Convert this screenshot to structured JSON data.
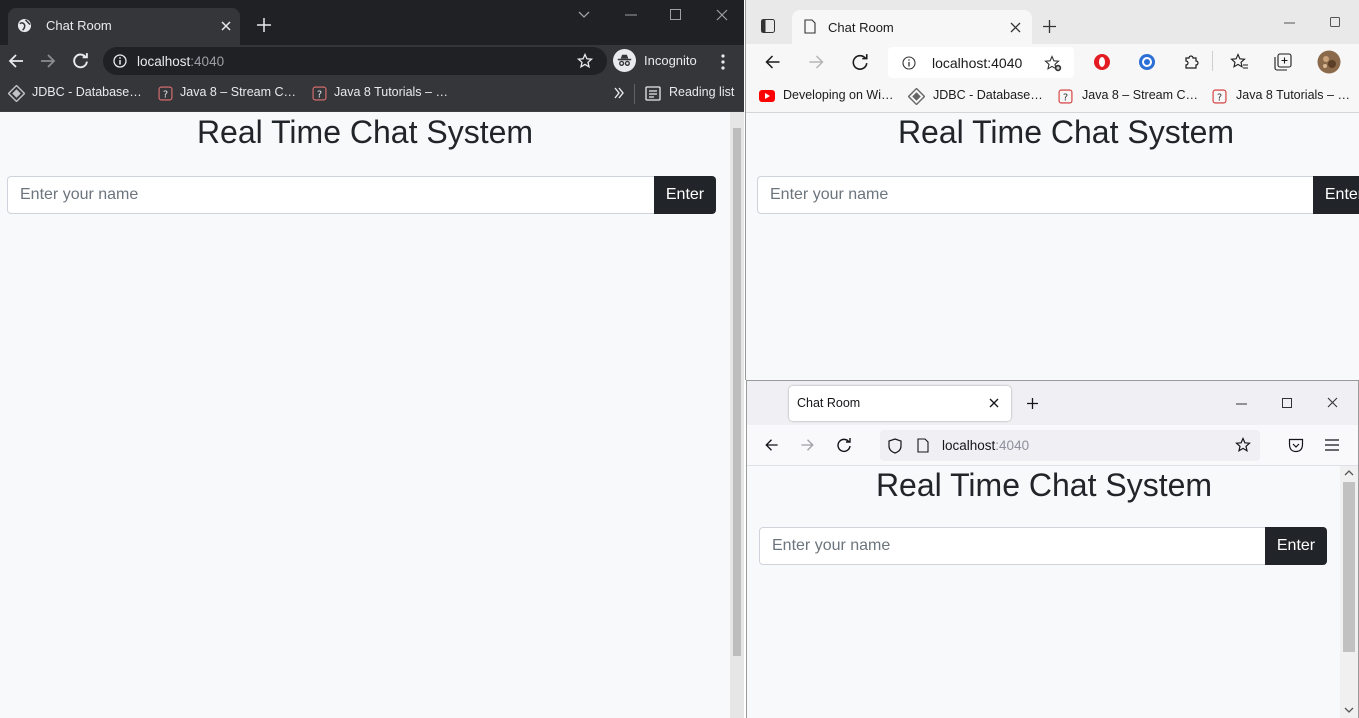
{
  "chrome": {
    "tab_title": "Chat Room",
    "url_host": "localhost",
    "url_port": ":4040",
    "profile_label": "Incognito",
    "bookmarks": [
      "JDBC - Database C...",
      "Java 8 – Stream Coll...",
      "Java 8 Tutorials – M..."
    ],
    "reading_list": "Reading list",
    "accent": "#202124"
  },
  "edge": {
    "tab_title": "Chat Room",
    "url": "localhost:4040",
    "bookmarks": [
      "Developing on Win...",
      "JDBC - Database C...",
      "Java 8 – Stream Coll...",
      "Java 8 Tutorials – M..."
    ]
  },
  "firefox": {
    "tab_title": "Chat Room",
    "url_host": "localhost",
    "url_port": ":4040"
  },
  "page": {
    "heading": "Real Time Chat System",
    "name_placeholder": "Enter your name",
    "enter_label": "Enter",
    "button_color": "#212529",
    "background": "#f8f9fa"
  }
}
